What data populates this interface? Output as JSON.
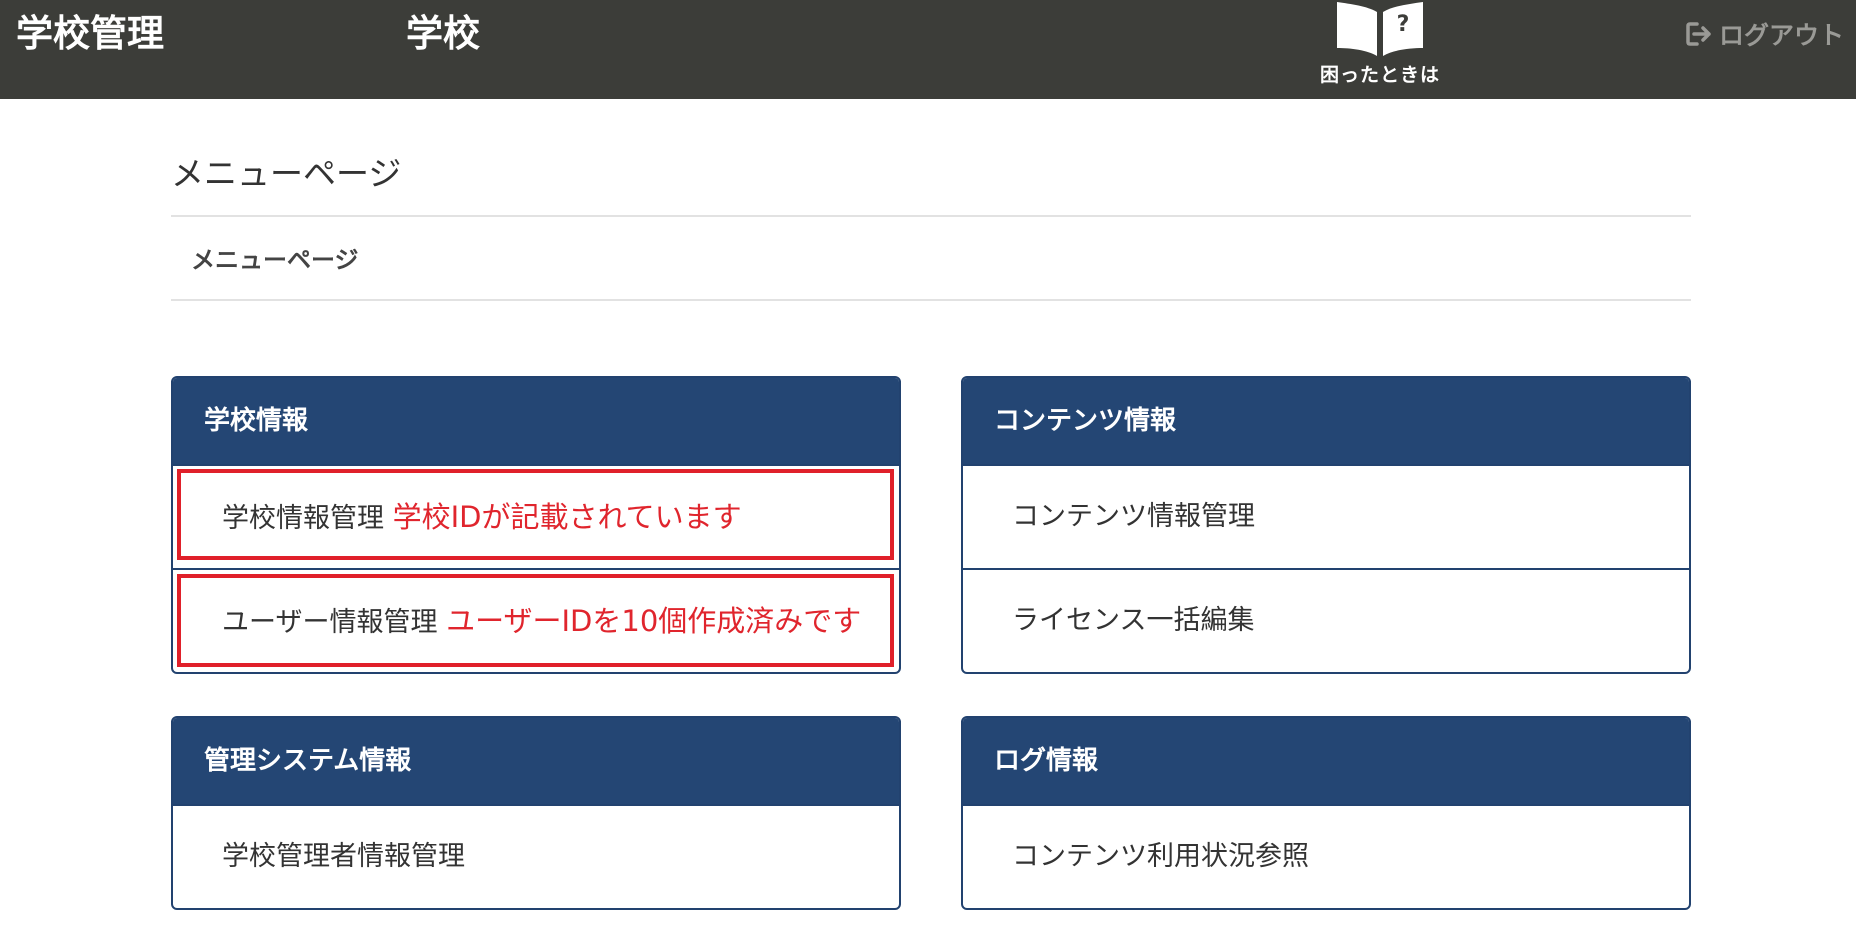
{
  "navbar": {
    "brand": "学校管理",
    "school": "学校",
    "help_label": "困ったときは",
    "help_icon": "book-question-icon",
    "logout_label": "ログアウト",
    "logout_icon": "sign-out-icon",
    "background": "#3c3d39"
  },
  "page": {
    "title": "メニューページ",
    "breadcrumb": "メニューページ"
  },
  "panels": [
    {
      "title": "学校情報",
      "items": [
        {
          "label": "学校情報管理",
          "note": "学校IDが記載されています"
        },
        {
          "label": "ユーザー情報管理",
          "note": "ユーザーIDを10個作成済みです"
        }
      ]
    },
    {
      "title": "コンテンツ情報",
      "items": [
        {
          "label": "コンテンツ情報管理"
        },
        {
          "label": "ライセンス一括編集"
        }
      ]
    },
    {
      "title": "管理システム情報",
      "items": [
        {
          "label": "学校管理者情報管理"
        }
      ]
    },
    {
      "title": "ログ情報",
      "items": [
        {
          "label": "コンテンツ利用状況参照"
        }
      ]
    }
  ],
  "colors": {
    "panel_header": "#244674",
    "annotation": "#e0252d"
  }
}
